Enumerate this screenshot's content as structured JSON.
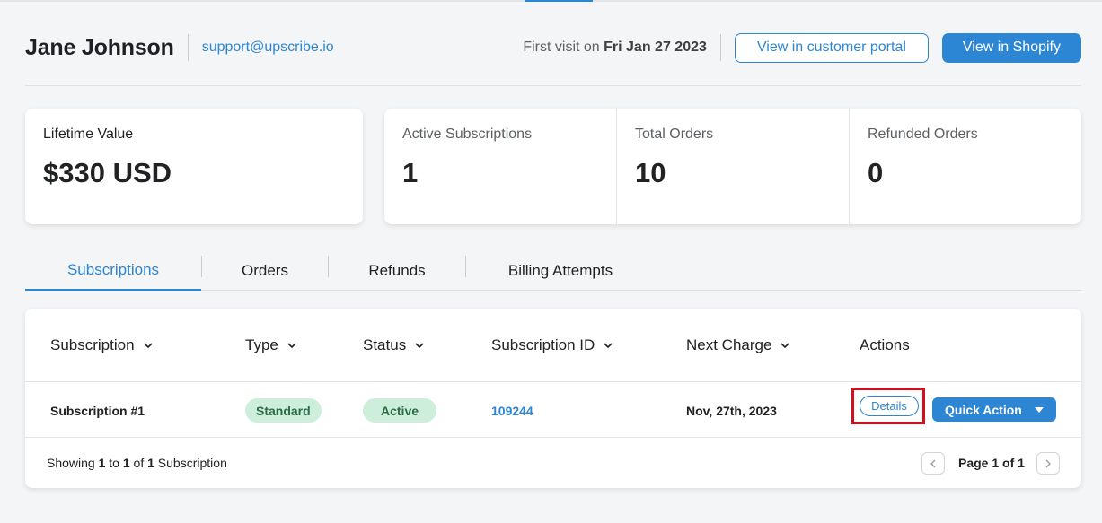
{
  "header": {
    "customer_name": "Jane Johnson",
    "email": "support@upscribe.io",
    "first_visit_label": "First visit on ",
    "first_visit_date": "Fri Jan 27 2023",
    "portal_button": "View in customer portal",
    "shopify_button": "View in Shopify"
  },
  "stats": {
    "lifetime_value_label": "Lifetime Value",
    "lifetime_value": "$330 USD",
    "active_subscriptions_label": "Active Subscriptions",
    "active_subscriptions": "1",
    "total_orders_label": "Total Orders",
    "total_orders": "10",
    "refunded_orders_label": "Refunded Orders",
    "refunded_orders": "0"
  },
  "tabs": [
    {
      "label": "Subscriptions",
      "active": true
    },
    {
      "label": "Orders",
      "active": false
    },
    {
      "label": "Refunds",
      "active": false
    },
    {
      "label": "Billing Attempts",
      "active": false
    }
  ],
  "table": {
    "columns": [
      "Subscription",
      "Type",
      "Status",
      "Subscription ID",
      "Next Charge",
      "Actions"
    ],
    "rows": [
      {
        "subscription": "Subscription #1",
        "type": "Standard",
        "status": "Active",
        "subscription_id": "109244",
        "next_charge": "Nov, 27th, 2023",
        "details_button": "Details",
        "quick_action_button": "Quick Action"
      }
    ],
    "footer": {
      "showing": "Showing ",
      "from": "1",
      "to_word": " to ",
      "to": "1",
      "of_word": " of ",
      "total": "1",
      "noun": " Subscription",
      "page_label": "Page 1 of 1"
    }
  },
  "colors": {
    "accent": "#2c86d4",
    "pill_bg": "#cdeedb",
    "pill_text": "#2b6b45",
    "highlight": "#d0101b"
  },
  "icons": [
    "chevron-down-icon",
    "caret-down-icon",
    "chevron-left-icon",
    "chevron-right-icon"
  ]
}
